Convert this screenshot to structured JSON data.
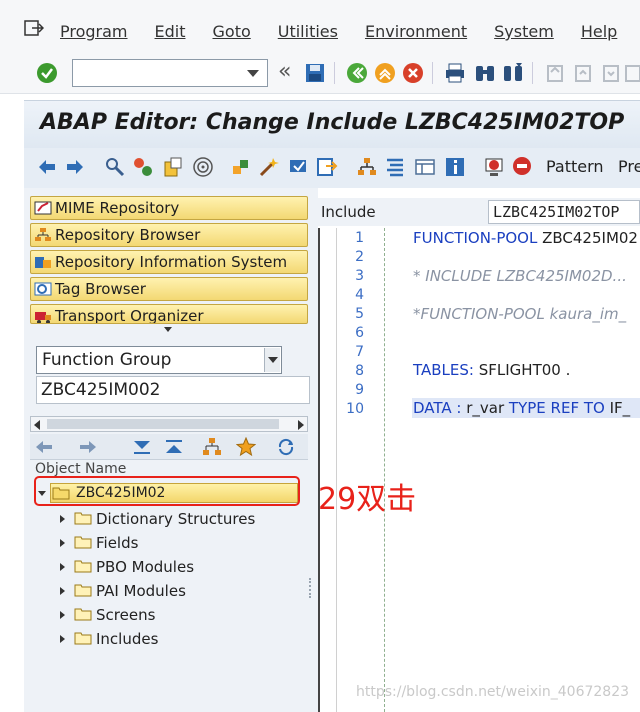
{
  "menu": {
    "items": [
      "Program",
      "Edit",
      "Goto",
      "Utilities",
      "Environment",
      "System",
      "Help"
    ]
  },
  "toolbar": {
    "command_value": "",
    "icons": [
      "enter-icon",
      "save-icon",
      "back-icon",
      "exit-icon",
      "cancel-icon",
      "print-icon",
      "find-icon",
      "find-next-icon"
    ]
  },
  "title": "ABAP Editor: Change Include LZBC425IM02TOP",
  "app_toolbar": {
    "pattern_label": "Pattern",
    "pretty_label": "Pre"
  },
  "navigation": {
    "buttons": [
      "MIME Repository",
      "Repository Browser",
      "Repository Information System",
      "Tag Browser",
      "Transport Organizer"
    ]
  },
  "object_selector": {
    "type_value": "Function Group",
    "name_value": "ZBC425IM002"
  },
  "tree": {
    "header": "Object Name",
    "root": "ZBC425IM02",
    "children": [
      "Dictionary Structures",
      "Fields",
      "PBO Modules",
      "PAI Modules",
      "Screens",
      "Includes"
    ]
  },
  "annotation": "29双击",
  "editor": {
    "include_label": "Include",
    "include_value": "LZBC425IM02TOP",
    "line_numbers": [
      "1",
      "2",
      "3",
      "4",
      "5",
      "6",
      "7",
      "8",
      "9",
      "10"
    ],
    "lines": {
      "l1_kw": "FUNCTION-POOL",
      "l1_rest": " ZBC425IM02",
      "l3": "* INCLUDE LZBC425IM02D...",
      "l5": "*FUNCTION-POOL   kaura_im_",
      "l8_kw": "TABLES:",
      "l8_rest": " SFLIGHT00 .",
      "l10_kw1": "DATA :",
      "l10_mid": " r_var ",
      "l10_kw2": "TYPE REF TO",
      "l10_rest": "  IF_"
    }
  },
  "watermark": "https://blog.csdn.net/weixin_40672823",
  "colors": {
    "highlight_red": "#e8221a",
    "nav_yellow": "#f3d873",
    "keyword_blue": "#1a3fc0"
  }
}
